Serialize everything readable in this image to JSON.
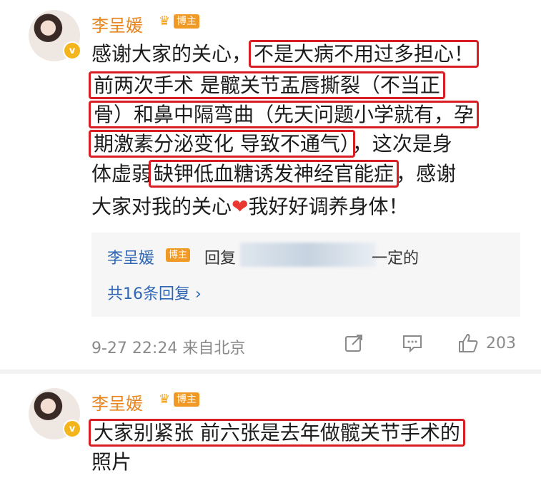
{
  "comment1": {
    "username": "李呈媛",
    "badge": "博主",
    "lines": [
      {
        "pre": "感谢大家的关心，",
        "hl": "不是大病不用过多担心！",
        "post": ""
      },
      {
        "pre": "",
        "hl": "前两次手术 是髋关节盂唇撕裂（不当正",
        "post": ""
      },
      {
        "pre": "",
        "hl": "骨）和鼻中隔弯曲（先天问题小学就有，孕",
        "post": ""
      },
      {
        "pre": "",
        "hl": "期激素分泌变化 导致不通气）",
        "post": "，这次是身"
      },
      {
        "pre": "体虚弱",
        "hl": "缺钾低血糖诱发神经官能症",
        "post": "，感谢"
      },
      {
        "pre": "大家对我的关心",
        "heart": "❤",
        "post": "我好好调养身体！"
      }
    ],
    "reply": {
      "name": "李呈媛",
      "badge": "博主",
      "prefix": "回复",
      "suffix": "一定的",
      "more": "共16条回复 ›"
    },
    "timestamp": "9-27 22:24 来自北京",
    "like_count": "203"
  },
  "comment2": {
    "username": "李呈媛",
    "badge": "博主",
    "line1": "大家别紧张 前六张是去年做髋关节手术的",
    "line2": "照片"
  },
  "colors": {
    "highlight_border": "#d81e24",
    "username": "#e8841c",
    "link": "#2f67b5",
    "badge_bg": "#f09a25",
    "verified": "#f3b51b"
  },
  "icons": [
    "verified-icon",
    "crown-icon",
    "share-icon",
    "comment-icon",
    "like-icon"
  ]
}
